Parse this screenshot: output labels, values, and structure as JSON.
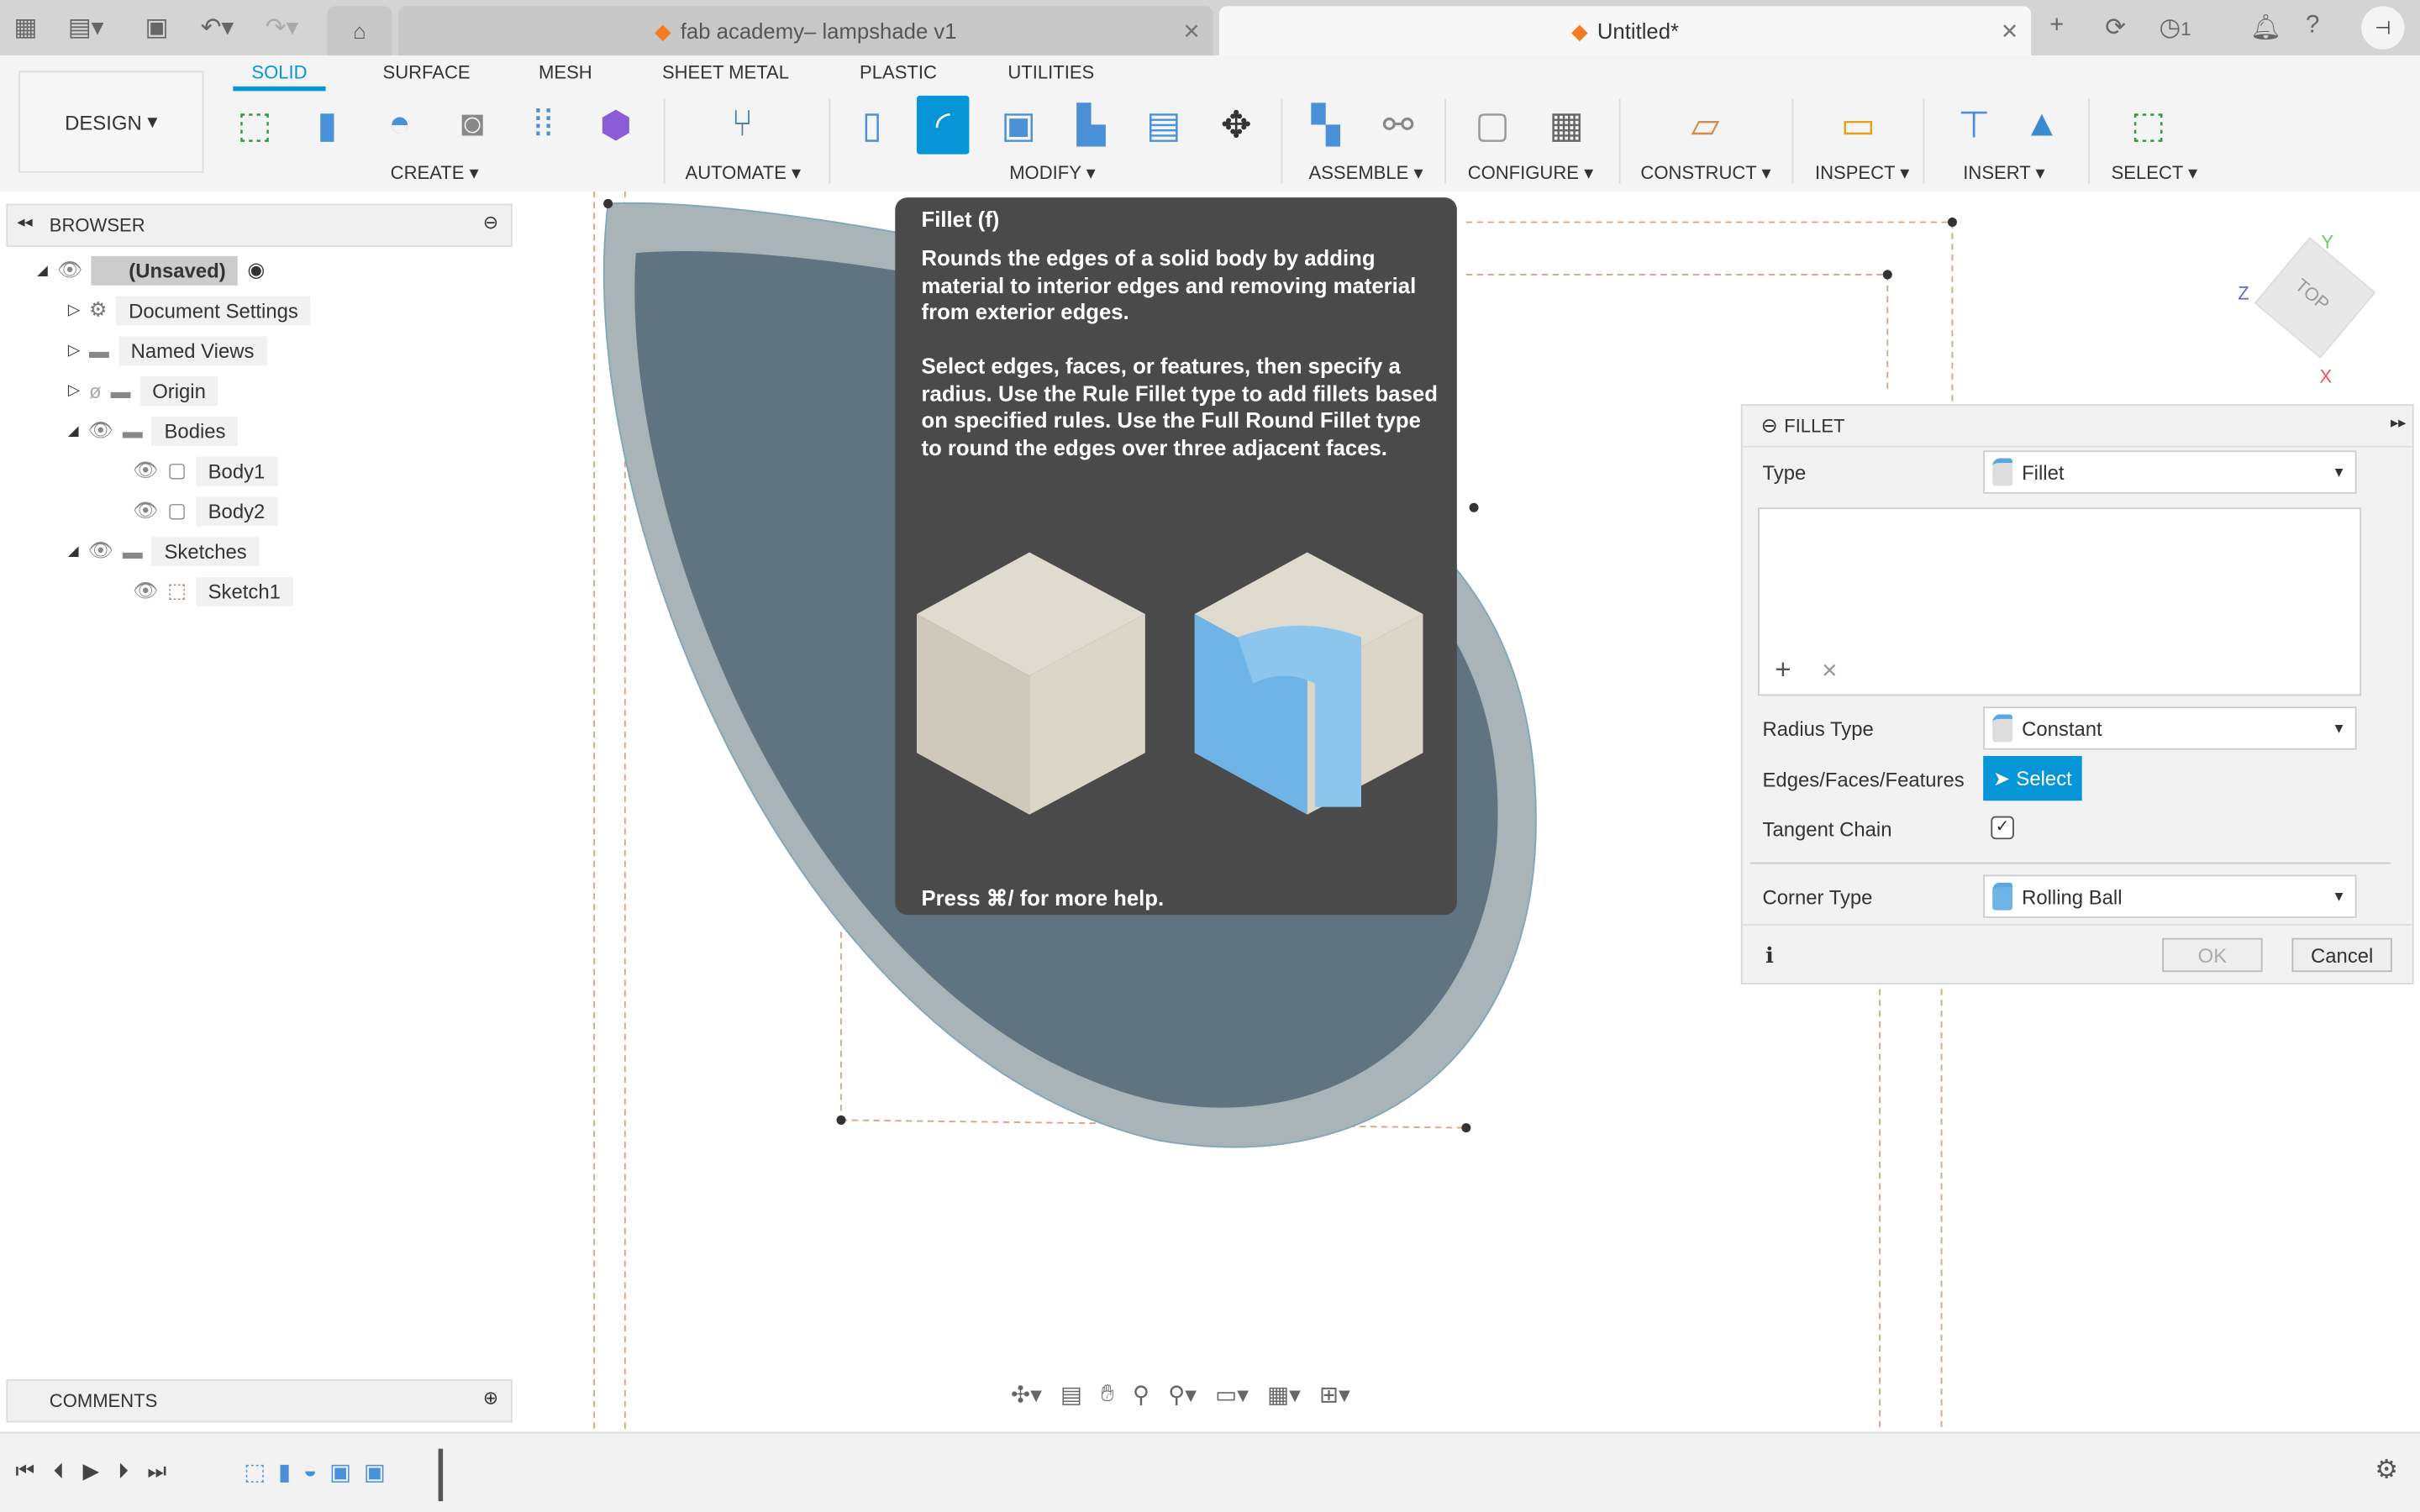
{
  "tabs": [
    {
      "label": "fab academy– lampshade v1",
      "active": false
    },
    {
      "label": "Untitled*",
      "active": true
    }
  ],
  "top_right": {
    "jobs_count": "1"
  },
  "workspace": "DESIGN",
  "ribbon_tabs": [
    "SOLID",
    "SURFACE",
    "MESH",
    "SHEET METAL",
    "PLASTIC",
    "UTILITIES"
  ],
  "active_ribbon_tab": "SOLID",
  "groups": [
    "CREATE",
    "AUTOMATE",
    "MODIFY",
    "ASSEMBLE",
    "CONFIGURE",
    "CONSTRUCT",
    "INSPECT",
    "INSERT",
    "SELECT"
  ],
  "browser": {
    "title": "BROWSER",
    "root": "(Unsaved)",
    "items": [
      "Document Settings",
      "Named Views",
      "Origin",
      "Bodies",
      "Body1",
      "Body2",
      "Sketches",
      "Sketch1"
    ]
  },
  "comments": "COMMENTS",
  "tooltip": {
    "title": "Fillet (f)",
    "p1": "Rounds the edges of a solid body by adding material to interior edges and removing material from exterior edges.",
    "p2": "Select edges, faces, or features, then specify a radius. Use the Rule Fillet type to add fillets based on specified rules. Use the Full Round Fillet type to round the edges over three adjacent faces.",
    "help": "Press ⌘/ for more help."
  },
  "fillet": {
    "title": "FILLET",
    "type_label": "Type",
    "type_value": "Fillet",
    "radius_type_label": "Radius Type",
    "radius_type_value": "Constant",
    "edges_label": "Edges/Faces/Features",
    "select_label": "Select",
    "tangent_label": "Tangent Chain",
    "tangent_checked": true,
    "corner_label": "Corner Type",
    "corner_value": "Rolling Ball",
    "ok": "OK",
    "cancel": "Cancel"
  },
  "viewcube": {
    "face": "TOP",
    "axes": [
      "Y",
      "Z",
      "X"
    ]
  },
  "colors": {
    "accent": "#0696d7",
    "tooltip_bg": "#4a4a4a"
  }
}
